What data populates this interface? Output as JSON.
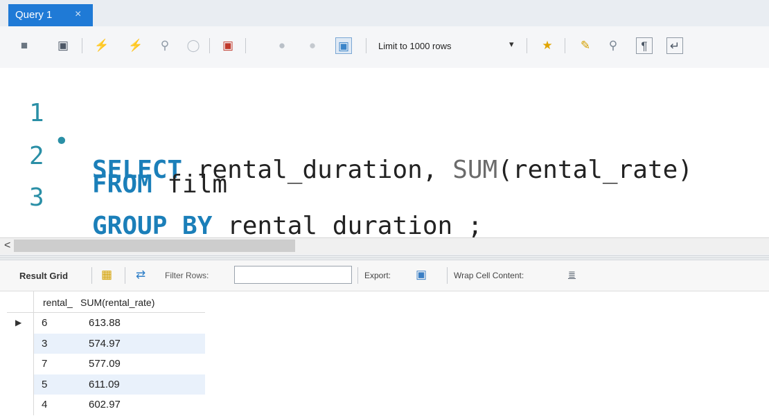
{
  "tab": {
    "title": "Query 1",
    "close": "×"
  },
  "toolbar": {
    "limit_label": "Limit to 1000 rows",
    "limit_arrow": "▾"
  },
  "editor": {
    "lines": [
      {
        "num": "1",
        "marker": "•"
      },
      {
        "num": "2",
        "marker": ""
      },
      {
        "num": "3",
        "marker": ""
      }
    ],
    "l1_kw": "SELECT",
    "l1_a": " rental_duration, ",
    "l1_fn": "SUM",
    "l1_b": "(rental_rate)",
    "l2_kw": "FROM",
    "l2_a": " film",
    "l3_kw": "GROUP BY",
    "l3_a": " rental_duration ;"
  },
  "scroll": {
    "left_arrow": "<"
  },
  "results_toolbar": {
    "result_grid_label": "Result Grid",
    "filter_label": "Filter Rows:",
    "filter_value": "",
    "export_label": "Export:",
    "wrap_label": "Wrap Cell Content:"
  },
  "grid": {
    "columns": [
      "rental_",
      "SUM(rental_rate)"
    ],
    "rows": [
      [
        "6",
        "613.88"
      ],
      [
        "3",
        "574.97"
      ],
      [
        "7",
        "577.09"
      ],
      [
        "5",
        "611.09"
      ],
      [
        "4",
        "602.97"
      ]
    ],
    "current_row_marker": "▶"
  },
  "colors": {
    "tab": "#1f7ad6",
    "keyword": "#1b7fb9",
    "function": "#6b6b6b",
    "line_number": "#2a8fa6",
    "alt_row": "#e9f1fb"
  }
}
